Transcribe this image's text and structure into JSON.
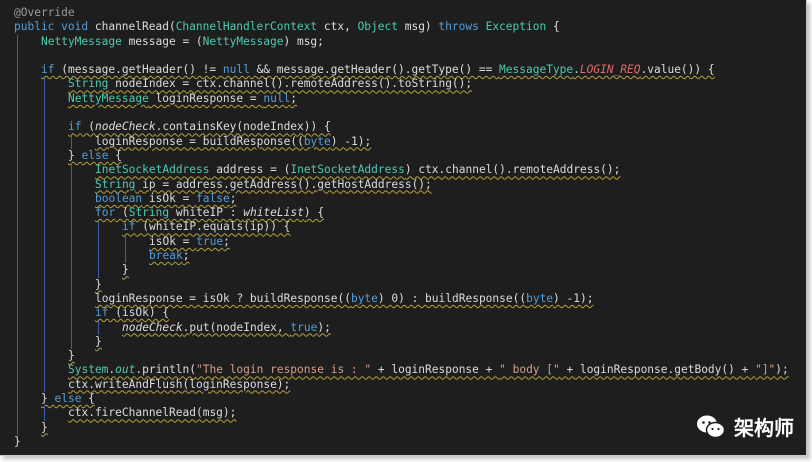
{
  "code_lines": [
    {
      "indent": 0,
      "tokens": [
        {
          "t": "@Override",
          "c": "an"
        }
      ]
    },
    {
      "indent": 0,
      "tokens": [
        {
          "t": "public",
          "c": "kw"
        },
        {
          "t": " "
        },
        {
          "t": "void",
          "c": "kw"
        },
        {
          "t": " channelRead("
        },
        {
          "t": "ChannelHandlerContext",
          "c": "ty"
        },
        {
          "t": " ctx, "
        },
        {
          "t": "Object",
          "c": "ty"
        },
        {
          "t": " msg) "
        },
        {
          "t": "throws",
          "c": "kw"
        },
        {
          "t": " "
        },
        {
          "t": "Exception",
          "c": "ty"
        },
        {
          "t": " {"
        }
      ]
    },
    {
      "indent": 1,
      "tokens": [
        {
          "t": "NettyMessage",
          "c": "ty"
        },
        {
          "t": " message = ("
        },
        {
          "t": "NettyMessage",
          "c": "ty"
        },
        {
          "t": ") msg;"
        }
      ]
    },
    {
      "indent": 0,
      "tokens": []
    },
    {
      "indent": 1,
      "squig": true,
      "tokens": [
        {
          "t": "if",
          "c": "kw"
        },
        {
          "t": " (message.getHeader() != "
        },
        {
          "t": "null",
          "c": "kw"
        },
        {
          "t": " && message.getHeader().getType() == "
        },
        {
          "t": "MessageType",
          "c": "ty"
        },
        {
          "t": "."
        },
        {
          "t": "LOGIN_REQ",
          "c": "cst"
        },
        {
          "t": ".value()) {"
        }
      ]
    },
    {
      "indent": 2,
      "squig": true,
      "tokens": [
        {
          "t": "String",
          "c": "ty"
        },
        {
          "t": " nodeIndex = ctx.channel().remoteAddress().toString();"
        }
      ]
    },
    {
      "indent": 2,
      "squig": true,
      "tokens": [
        {
          "t": "NettyMessage",
          "c": "ty"
        },
        {
          "t": " loginResponse = "
        },
        {
          "t": "null",
          "c": "kw"
        },
        {
          "t": ";"
        }
      ]
    },
    {
      "indent": 0,
      "tokens": []
    },
    {
      "indent": 2,
      "squig": true,
      "tokens": [
        {
          "t": "if",
          "c": "kw"
        },
        {
          "t": " ("
        },
        {
          "t": "nodeCheck",
          "c": "it"
        },
        {
          "t": ".containsKey(nodeIndex)) {"
        }
      ]
    },
    {
      "indent": 3,
      "squig": true,
      "tokens": [
        {
          "t": "loginResponse = buildResponse(("
        },
        {
          "t": "byte",
          "c": "kw"
        },
        {
          "t": ") -1);"
        }
      ]
    },
    {
      "indent": 2,
      "squig": true,
      "tokens": [
        {
          "t": "} "
        },
        {
          "t": "else",
          "c": "kw"
        },
        {
          "t": " {"
        }
      ]
    },
    {
      "indent": 3,
      "squig": true,
      "tokens": [
        {
          "t": "InetSocketAddress",
          "c": "ty"
        },
        {
          "t": " address = ("
        },
        {
          "t": "InetSocketAddress",
          "c": "ty"
        },
        {
          "t": ") ctx.channel().remoteAddress();"
        }
      ]
    },
    {
      "indent": 3,
      "squig": true,
      "tokens": [
        {
          "t": "String",
          "c": "ty"
        },
        {
          "t": " ip = address.getAddress().getHostAddress();"
        }
      ]
    },
    {
      "indent": 3,
      "squig": true,
      "tokens": [
        {
          "t": "boolean",
          "c": "kw"
        },
        {
          "t": " isOk = "
        },
        {
          "t": "false",
          "c": "kw"
        },
        {
          "t": ";"
        }
      ]
    },
    {
      "indent": 3,
      "squig": true,
      "tokens": [
        {
          "t": "for",
          "c": "kw"
        },
        {
          "t": " ("
        },
        {
          "t": "String",
          "c": "ty"
        },
        {
          "t": " whiteIP : "
        },
        {
          "t": "whiteList",
          "c": "it"
        },
        {
          "t": ") {"
        }
      ]
    },
    {
      "indent": 4,
      "squig": true,
      "tokens": [
        {
          "t": "if",
          "c": "kw"
        },
        {
          "t": " (whiteIP.equals(ip)) {"
        }
      ]
    },
    {
      "indent": 5,
      "squig": true,
      "tokens": [
        {
          "t": "isOk = "
        },
        {
          "t": "true",
          "c": "kw"
        },
        {
          "t": ";"
        }
      ]
    },
    {
      "indent": 5,
      "squig": true,
      "tokens": [
        {
          "t": "break",
          "c": "kw"
        },
        {
          "t": ";"
        }
      ]
    },
    {
      "indent": 4,
      "squig": true,
      "tokens": [
        {
          "t": "}"
        }
      ]
    },
    {
      "indent": 3,
      "squig": true,
      "tokens": [
        {
          "t": "}"
        }
      ]
    },
    {
      "indent": 3,
      "squig": true,
      "tokens": [
        {
          "t": "loginResponse = isOk ? buildResponse(("
        },
        {
          "t": "byte",
          "c": "kw"
        },
        {
          "t": ") 0) : buildResponse(("
        },
        {
          "t": "byte",
          "c": "kw"
        },
        {
          "t": ") -1);"
        }
      ]
    },
    {
      "indent": 3,
      "squig": true,
      "tokens": [
        {
          "t": "if",
          "c": "kw"
        },
        {
          "t": " (isOk) {"
        }
      ]
    },
    {
      "indent": 4,
      "squig": true,
      "tokens": [
        {
          "t": "nodeCheck",
          "c": "it"
        },
        {
          "t": ".put(nodeIndex, "
        },
        {
          "t": "true",
          "c": "kw"
        },
        {
          "t": ");"
        }
      ]
    },
    {
      "indent": 3,
      "squig": true,
      "tokens": [
        {
          "t": "}"
        }
      ]
    },
    {
      "indent": 2,
      "squig": true,
      "tokens": [
        {
          "t": "}"
        }
      ]
    },
    {
      "indent": 2,
      "squig": true,
      "tokens": [
        {
          "t": "System",
          "c": "ty"
        },
        {
          "t": "."
        },
        {
          "t": "out",
          "c": "fld"
        },
        {
          "t": ".println("
        },
        {
          "t": "\"The login response is : \"",
          "c": "str"
        },
        {
          "t": " + loginResponse + "
        },
        {
          "t": "\" body [\"",
          "c": "str"
        },
        {
          "t": " + loginResponse.getBody() + "
        },
        {
          "t": "\"]\"",
          "c": "str"
        },
        {
          "t": ");"
        }
      ]
    },
    {
      "indent": 2,
      "squig": true,
      "tokens": [
        {
          "t": "ctx.writeAndFlush(loginResponse);"
        }
      ]
    },
    {
      "indent": 1,
      "squig": true,
      "tokens": [
        {
          "t": "} "
        },
        {
          "t": "else",
          "c": "kw"
        },
        {
          "t": " {"
        }
      ]
    },
    {
      "indent": 2,
      "squig": true,
      "tokens": [
        {
          "t": "ctx.fireChannelRead(msg);"
        }
      ]
    },
    {
      "indent": 1,
      "squig": true,
      "tokens": [
        {
          "t": "}"
        }
      ]
    },
    {
      "indent": 0,
      "tokens": [
        {
          "t": "}"
        }
      ]
    }
  ],
  "watermark": {
    "icon": "wechat-icon",
    "text": "架构师"
  },
  "colors": {
    "background": "#1e1e1e",
    "keyword": "#569cd6",
    "type": "#4ec9b0",
    "annotation": "#9b9b9b",
    "string": "#d69d85",
    "constant": "#e06b6b",
    "indent_guide": "#3b5ea8"
  }
}
